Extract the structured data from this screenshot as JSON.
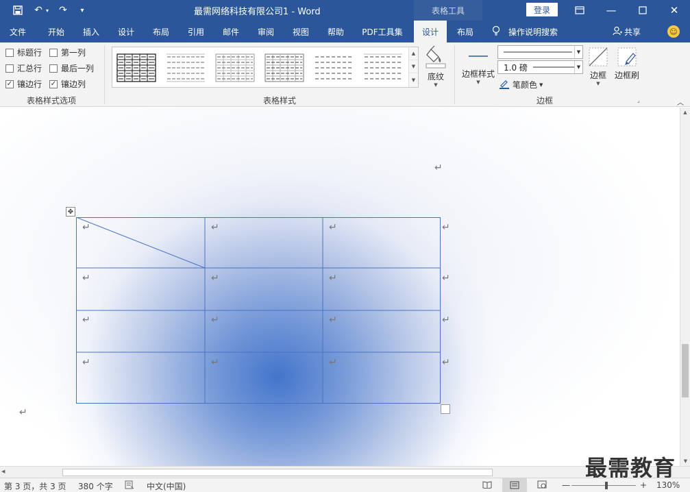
{
  "titlebar": {
    "title": "最需网络科技有限公司1  -  Word",
    "context_tab": "表格工具",
    "login": "登录",
    "save_icon": "save-icon",
    "undo_icon": "undo-icon",
    "redo_icon": "redo-icon"
  },
  "tabs": [
    "文件",
    "开始",
    "插入",
    "设计",
    "布局",
    "引用",
    "邮件",
    "审阅",
    "视图",
    "帮助",
    "PDF工具集",
    "设计",
    "布局"
  ],
  "active_tab_index": 11,
  "tell_me": "操作说明搜索",
  "share": "共享",
  "ribbon": {
    "style_options": {
      "items": [
        {
          "label": "标题行",
          "checked": false
        },
        {
          "label": "第一列",
          "checked": false
        },
        {
          "label": "汇总行",
          "checked": false
        },
        {
          "label": "最后一列",
          "checked": false
        },
        {
          "label": "镶边行",
          "checked": true
        },
        {
          "label": "镶边列",
          "checked": true
        }
      ],
      "group_label": "表格样式选项"
    },
    "table_styles": {
      "group_label": "表格样式",
      "shading_label": "底纹"
    },
    "borders": {
      "border_styles_label": "边框样式",
      "weight": "1.0 磅",
      "pen_color_label": "笔颜色",
      "borders_label": "边框",
      "painter_label": "边框刷",
      "group_label": "边框"
    }
  },
  "document": {
    "paragraph_mark": "↵"
  },
  "statusbar": {
    "page": "第 3 页，共 3 页",
    "words": "380 个字",
    "language": "中文(中国)",
    "zoom": "130%",
    "zoom_level": 1.3
  },
  "watermark": "最需教育",
  "colors": {
    "brand": "#2b579a",
    "table_border": "#4a72c4"
  }
}
